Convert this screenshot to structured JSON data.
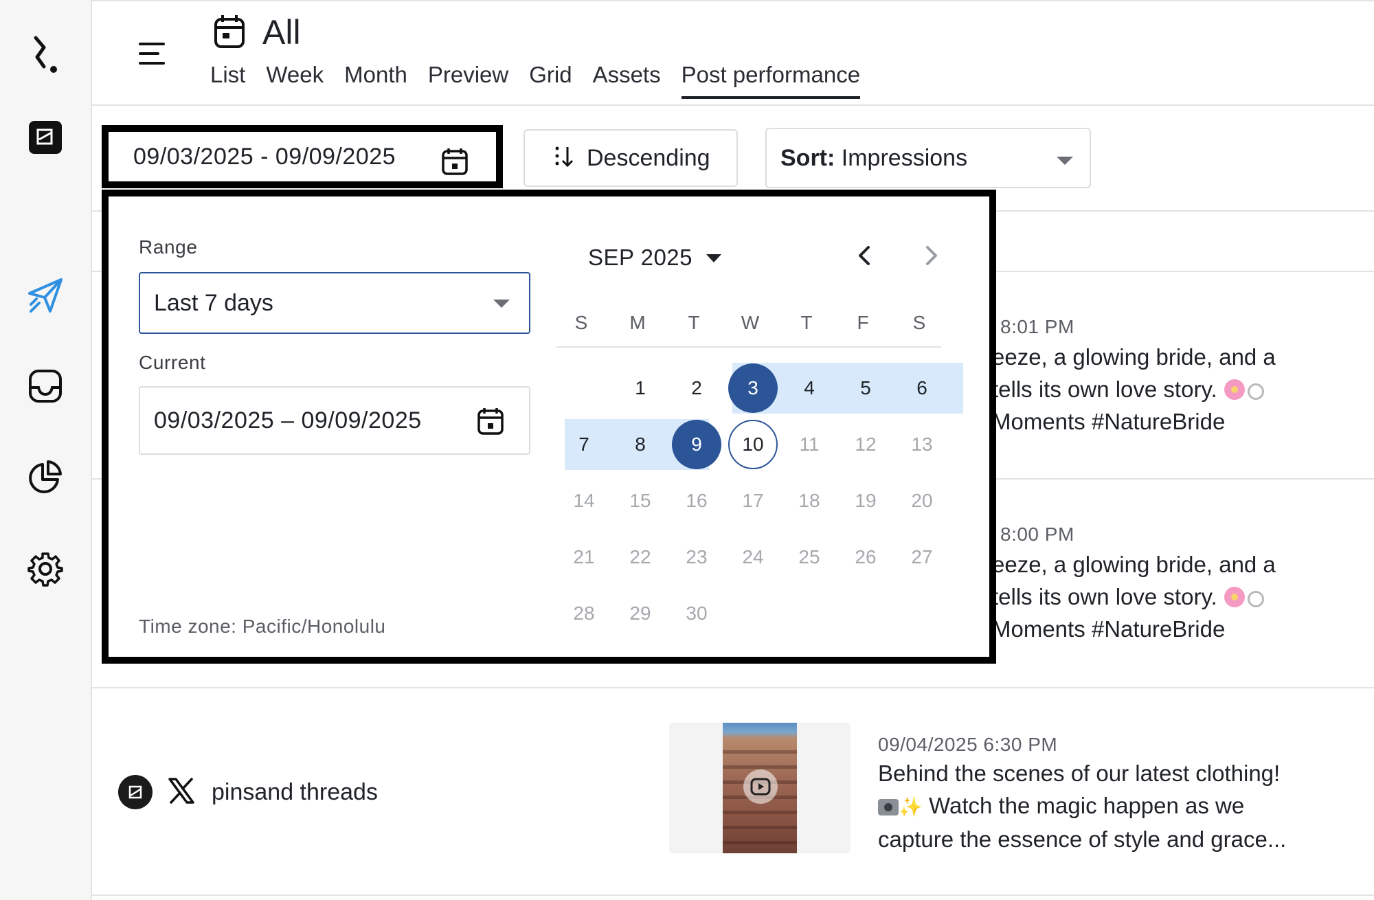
{
  "header": {
    "title": "All",
    "tabs": [
      {
        "label": "List"
      },
      {
        "label": "Week"
      },
      {
        "label": "Month"
      },
      {
        "label": "Preview"
      },
      {
        "label": "Grid"
      },
      {
        "label": "Assets"
      },
      {
        "label": "Post performance",
        "active": true
      }
    ]
  },
  "toolbar": {
    "date_range": "09/03/2025 - 09/09/2025",
    "order_label": "Descending",
    "sort_prefix": "Sort:",
    "sort_value": "Impressions"
  },
  "date_picker": {
    "range_label": "Range",
    "range_value": "Last 7 days",
    "current_label": "Current",
    "current_value": "09/03/2025 – 09/09/2025",
    "timezone": "Time zone: Pacific/Honolulu",
    "month_label": "SEP 2025",
    "weekdays": [
      "S",
      "M",
      "T",
      "W",
      "T",
      "F",
      "S"
    ],
    "weeks": [
      [
        "",
        "1",
        "2",
        "3",
        "4",
        "5",
        "6"
      ],
      [
        "7",
        "8",
        "9",
        "10",
        "11",
        "12",
        "13"
      ],
      [
        "14",
        "15",
        "16",
        "17",
        "18",
        "19",
        "20"
      ],
      [
        "21",
        "22",
        "23",
        "24",
        "25",
        "26",
        "27"
      ],
      [
        "28",
        "29",
        "30",
        "",
        "",
        "",
        ""
      ]
    ],
    "range_start": "3",
    "range_end": "9",
    "today": "10"
  },
  "posts": [
    {
      "time": "8:01 PM",
      "lines": [
        "eeze, a glowing bride, and a",
        "tells its own love story.",
        "Moments #NatureBride"
      ]
    },
    {
      "time": "8:00 PM",
      "lines": [
        "eeze, a glowing bride, and a",
        "tells its own love story.",
        "Moments #NatureBride"
      ]
    },
    {
      "account": "pinsand threads",
      "time": "09/04/2025 6:30 PM",
      "lines": [
        "Behind the scenes of our latest clothing!",
        "Watch the magic happen as we",
        "capture the essence of style and grace..."
      ]
    }
  ],
  "colors": {
    "accent": "#2c5597",
    "range_fill": "#d7e9fb",
    "send_icon": "#2f8fe0"
  }
}
